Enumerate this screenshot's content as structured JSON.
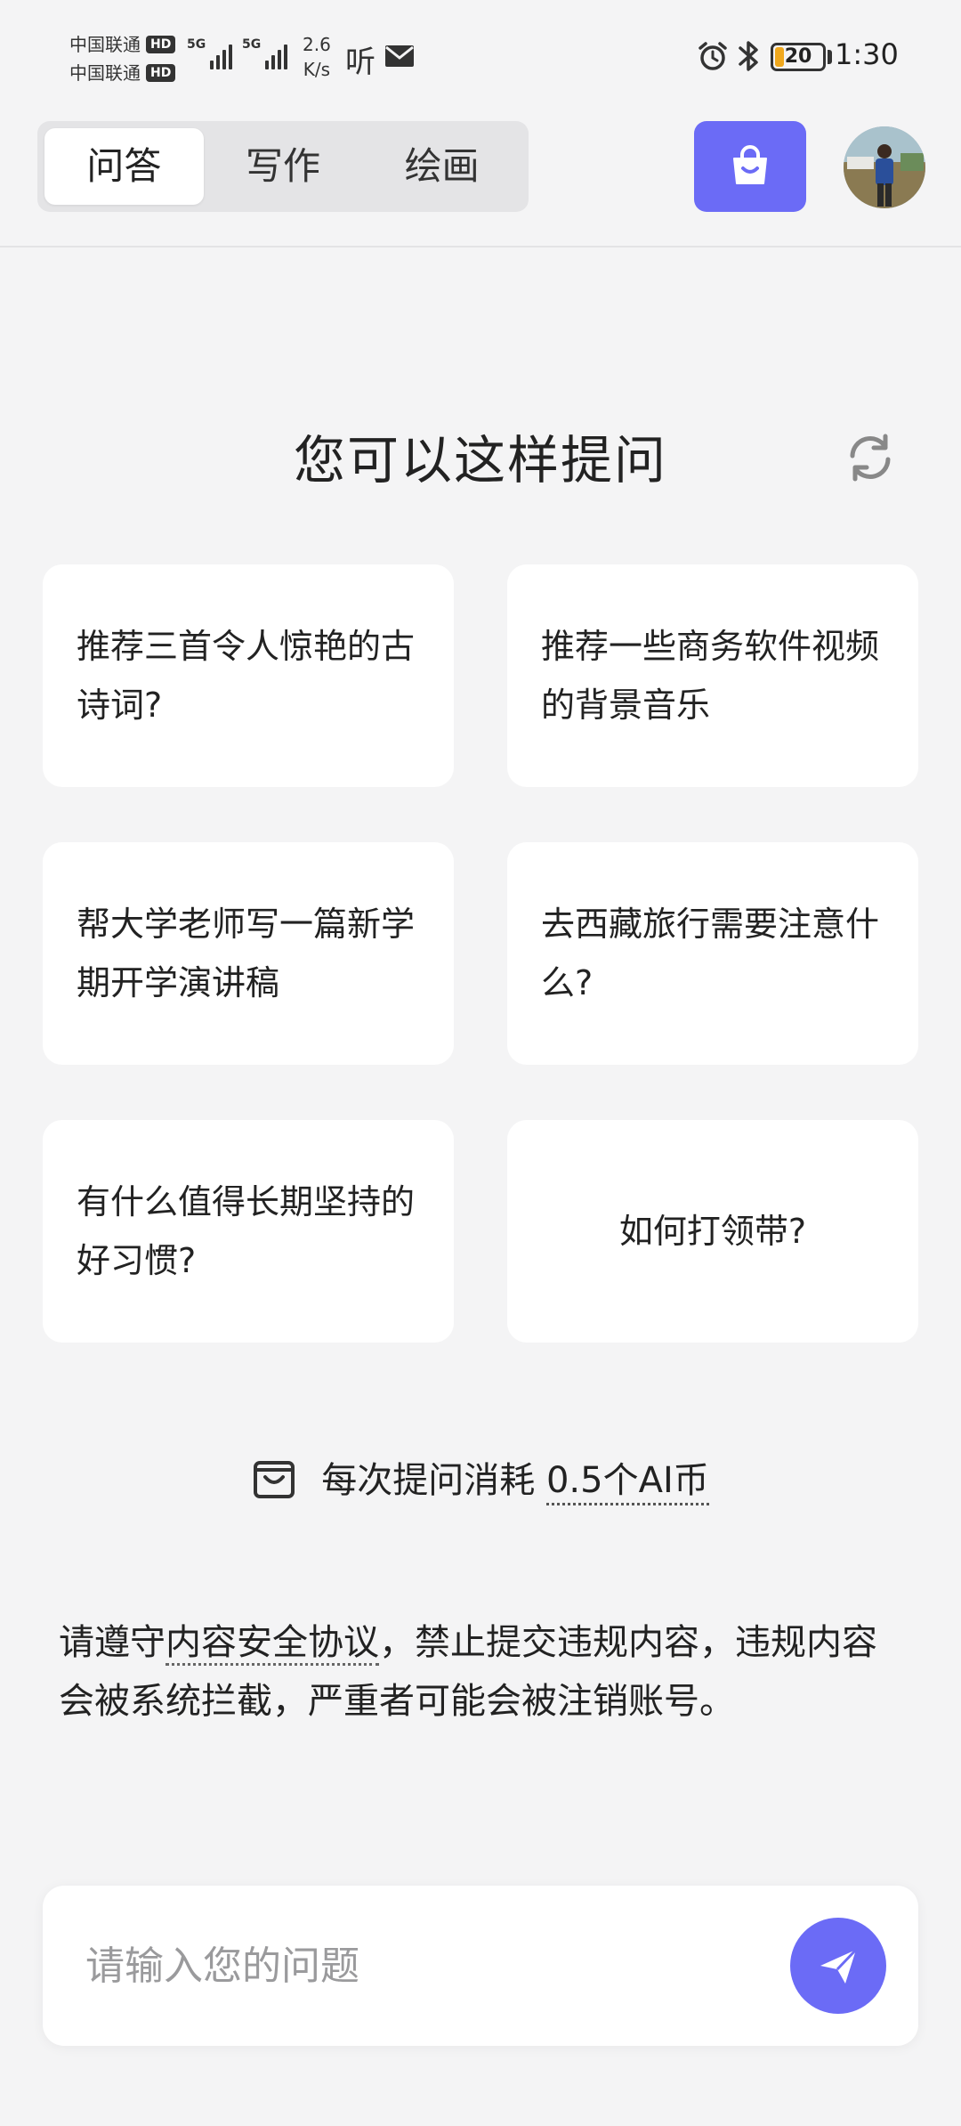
{
  "status_bar": {
    "carrier_1": "中国联通",
    "carrier_2": "中国联通",
    "hd_badge": "HD",
    "signal_tag": "5G",
    "net_speed_value": "2.6",
    "net_speed_unit": "K/s",
    "ting_glyph": "听",
    "battery_level": "20",
    "battery_fraction": 0.2,
    "time": "1:30",
    "icons": [
      "mail-icon",
      "alarm-icon",
      "bluetooth-icon"
    ]
  },
  "header": {
    "tabs": [
      {
        "label": "问答",
        "active": true
      },
      {
        "label": "写作",
        "active": false
      },
      {
        "label": "绘画",
        "active": false
      }
    ],
    "shop_icon": "shopping-bag-icon",
    "accent_color": "#6b6bf6"
  },
  "suggestions": {
    "title": "您可以这样提问",
    "refresh_icon": "refresh-icon",
    "items": [
      {
        "text": "推荐三首令人惊艳的古诗词?"
      },
      {
        "text": "推荐一些商务软件视频的背景音乐"
      },
      {
        "text": "帮大学老师写一篇新学期开学演讲稿"
      },
      {
        "text": "去西藏旅行需要注意什么?"
      },
      {
        "text": "有什么值得长期坚持的好习惯?"
      },
      {
        "text": "如何打领带?"
      }
    ]
  },
  "cost": {
    "prefix": "每次提问消耗",
    "amount": "0.5个AI币",
    "icon": "cart-icon"
  },
  "notice": {
    "before": "请遵守",
    "link": "内容安全协议",
    "after": "，禁止提交违规内容，违规内容会被系统拦截，严重者可能会被注销账号。"
  },
  "input": {
    "placeholder": "请输入您的问题",
    "value": "",
    "send_icon": "send-icon"
  }
}
